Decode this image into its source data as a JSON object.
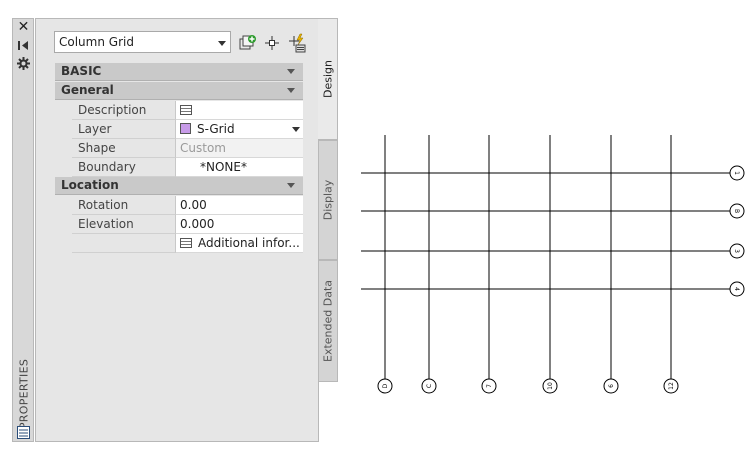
{
  "palette": {
    "title": "PROPERTIES",
    "icons": [
      "close-icon",
      "auto-hide-icon",
      "properties-menu-icon",
      "palette-settings-icon"
    ]
  },
  "selector": {
    "value": "Column Grid"
  },
  "toolbar": {
    "icons": [
      "add-selection-icon",
      "pickadd-icon",
      "quick-select-icon"
    ]
  },
  "tabs": [
    "Design",
    "Display",
    "Extended Data"
  ],
  "categories": {
    "basic": "BASIC",
    "general": "General",
    "location": "Location"
  },
  "general": {
    "description": {
      "label": "Description",
      "value": ""
    },
    "layer": {
      "label": "Layer",
      "value": "S-Grid"
    },
    "shape": {
      "label": "Shape",
      "value": "Custom"
    },
    "boundary": {
      "label": "Boundary",
      "value": "*NONE*"
    }
  },
  "location": {
    "rotation": {
      "label": "Rotation",
      "value": "0.00"
    },
    "elevation": {
      "label": "Elevation",
      "value": "0.000"
    },
    "additional": {
      "label": "",
      "value": "Additional infor..."
    }
  },
  "colors": {
    "layer_swatch": "#c79be8",
    "grid_line": "#000000"
  },
  "grid": {
    "row_bubbles": [
      "1",
      "B",
      "3",
      "4"
    ],
    "column_bubbles": [
      "D",
      "C",
      "7",
      "10",
      "6",
      "12"
    ]
  }
}
